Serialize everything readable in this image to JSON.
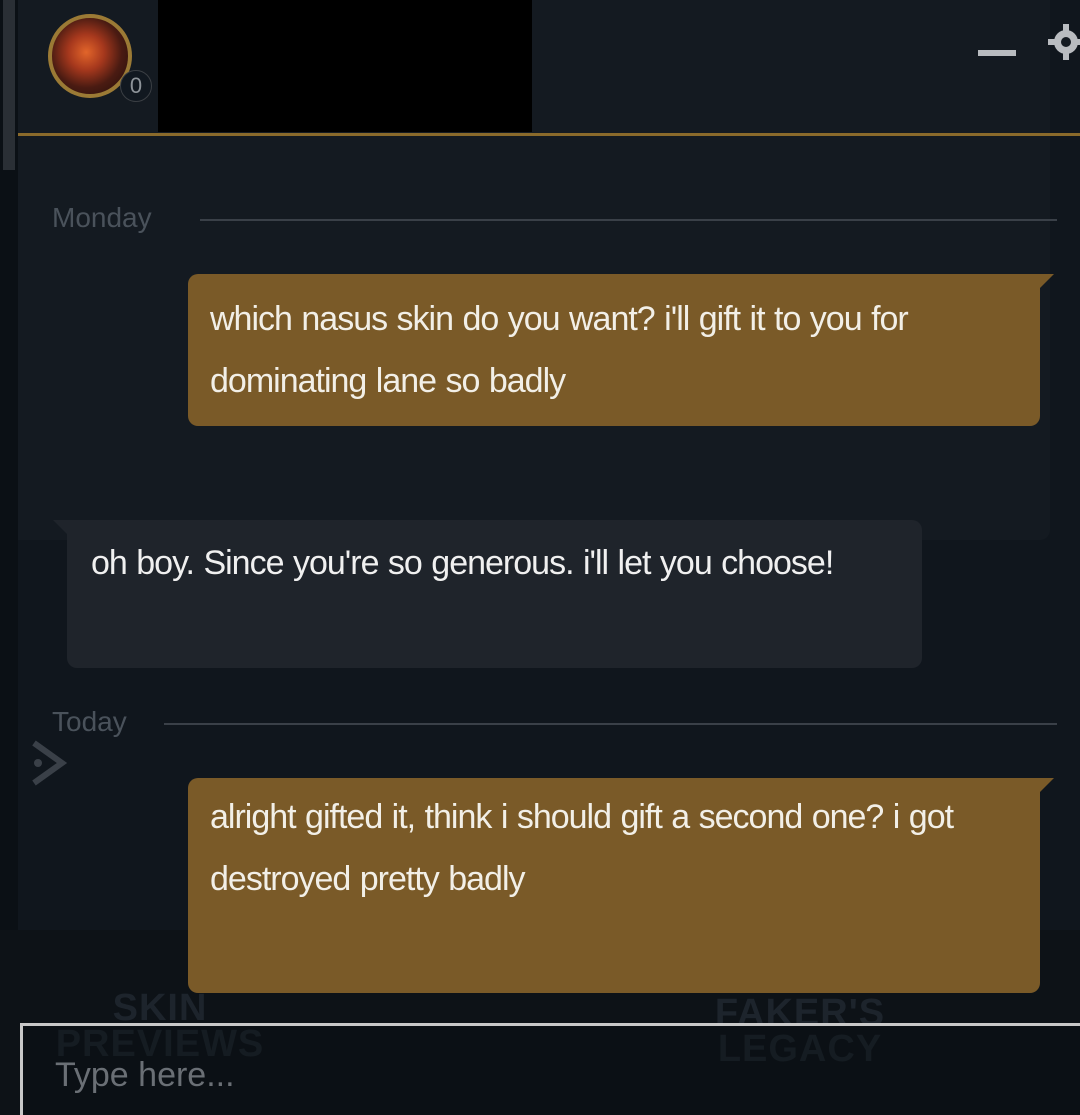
{
  "header": {
    "status_badge": "0",
    "colors": {
      "accent": "#8a6a2b",
      "outgoing_bubble": "#7a5a28",
      "incoming_bubble": "#1f242b"
    }
  },
  "conversation": {
    "separators": {
      "monday": "Monday",
      "today": "Today"
    },
    "messages": [
      {
        "direction": "outgoing",
        "text": "which nasus skin do you want? i'll gift it to you for dominating lane so badly"
      },
      {
        "direction": "incoming",
        "text": "oh boy. Since you're so generous. i'll let you choose!"
      },
      {
        "direction": "outgoing",
        "text": "alright gifted it, think i should gift a second one? i got destroyed pretty badly"
      }
    ]
  },
  "background": {
    "promo_left": "SKIN PREVIEWS",
    "promo_right": "FAKER'S LEGACY"
  },
  "input": {
    "placeholder": "Type here..."
  }
}
